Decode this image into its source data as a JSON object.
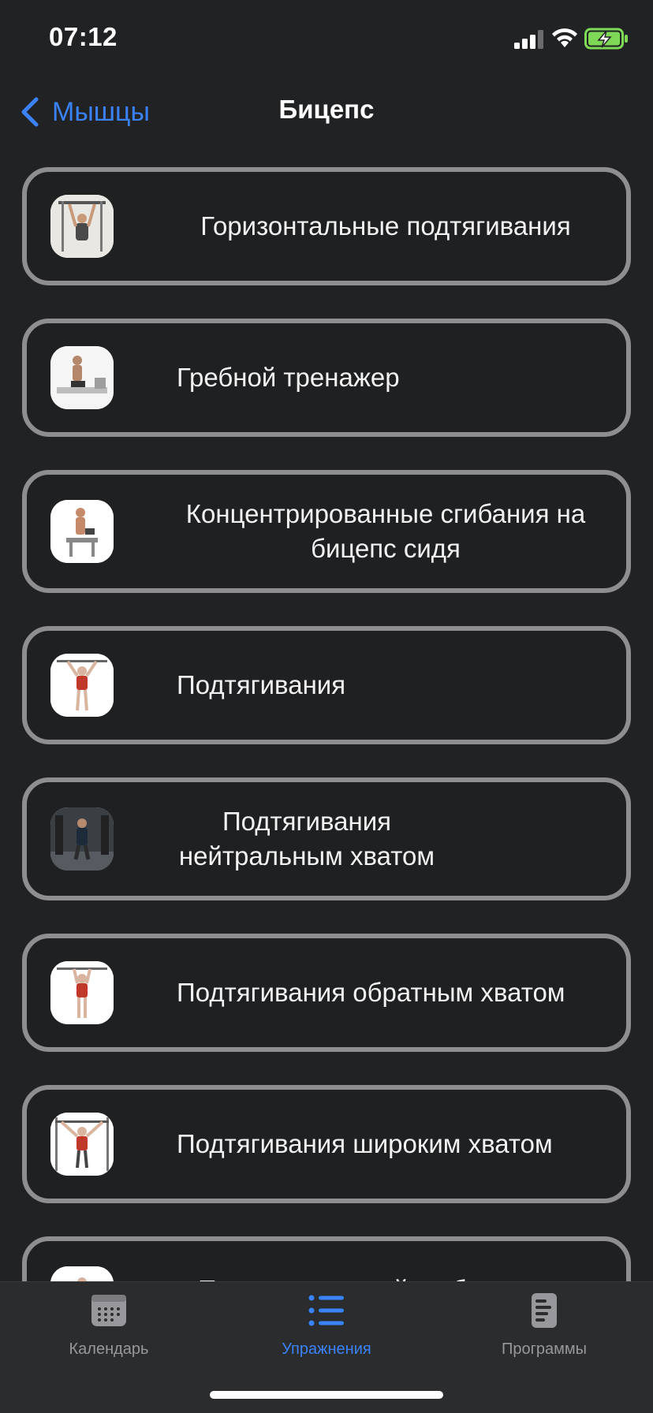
{
  "status_bar": {
    "time": "07:12"
  },
  "nav": {
    "back_label": "Мышцы",
    "title": "Бицепс"
  },
  "exercises": [
    {
      "label": "Горизонтальные подтягивания"
    },
    {
      "label": "Гребной тренажер"
    },
    {
      "label": "Концентрированные сгибания на бицепс сидя"
    },
    {
      "label": "Подтягивания"
    },
    {
      "label": "Подтягивания нейтральным хватом"
    },
    {
      "label": "Подтягивания обратным хватом"
    },
    {
      "label": "Подтягивания широким хватом"
    },
    {
      "label": "Подъем гантелей на бицепс на"
    }
  ],
  "tabs": [
    {
      "label": "Календарь",
      "icon": "calendar-icon"
    },
    {
      "label": "Упражнения",
      "icon": "list-icon"
    },
    {
      "label": "Программы",
      "icon": "document-icon"
    }
  ],
  "colors": {
    "accent": "#3b82f6",
    "background": "#212224",
    "card_border": "#8e8e90",
    "tab_inactive": "#98989c"
  }
}
